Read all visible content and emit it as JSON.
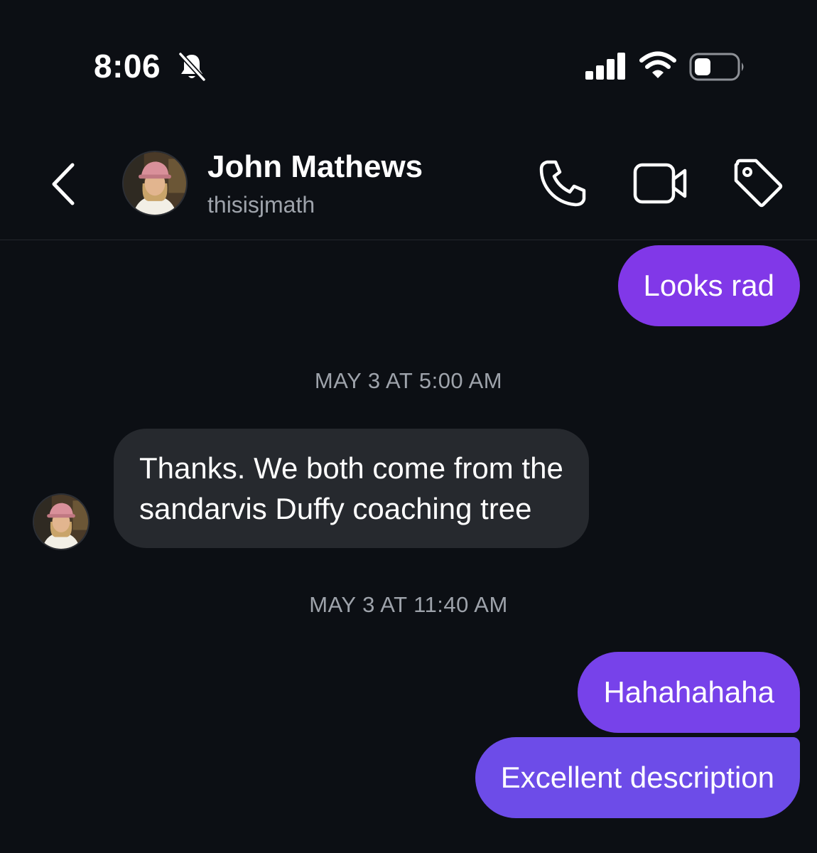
{
  "status_bar": {
    "time": "8:06",
    "mute_icon": "bell-slash-icon",
    "signal_icon": "cellular-signal-icon",
    "wifi_icon": "wifi-icon",
    "battery_icon": "battery-icon"
  },
  "header": {
    "back_icon": "chevron-left-icon",
    "contact_name": "John Mathews",
    "contact_handle": "thisisjmath",
    "actions": {
      "call_icon": "phone-icon",
      "video_icon": "video-camera-icon",
      "tag_icon": "tag-icon"
    }
  },
  "conversation": {
    "messages": [
      {
        "direction": "outgoing",
        "text": "Looks rad"
      },
      {
        "type": "timestamp",
        "text": "MAY 3 AT 5:00 AM"
      },
      {
        "direction": "incoming",
        "lines": [
          "Thanks. We both come from the",
          "sandarvis Duffy coaching tree"
        ]
      },
      {
        "type": "timestamp",
        "text": "MAY 3 AT 11:40 AM"
      },
      {
        "direction": "outgoing",
        "text": "Hahahahaha"
      },
      {
        "direction": "outgoing",
        "text": "Excellent description"
      }
    ]
  },
  "colors": {
    "background": "#0c0f14",
    "outgoing_bubble": "#8138e8",
    "incoming_bubble": "#26292e",
    "secondary_text": "#9ea3ab"
  }
}
